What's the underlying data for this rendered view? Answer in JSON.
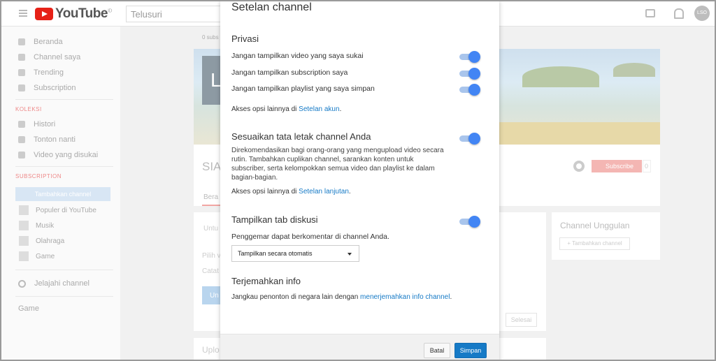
{
  "header": {
    "logo_text": "YouTube",
    "logo_sup": "ID",
    "search_placeholder": "Telusuri",
    "avatar_text": "LSO"
  },
  "sidebar": {
    "main_items": [
      {
        "label": "Beranda",
        "icon": "home-icon"
      },
      {
        "label": "Channel saya",
        "icon": "person-icon"
      },
      {
        "label": "Trending",
        "icon": "flame-icon"
      },
      {
        "label": "Subscription",
        "icon": "subscription-icon"
      }
    ],
    "collection_heading": "KOLEKSI",
    "collection_items": [
      {
        "label": "Histori",
        "icon": "hourglass-icon"
      },
      {
        "label": "Tonton nanti",
        "icon": "clock-icon"
      },
      {
        "label": "Video yang disukai",
        "icon": "thumb-up-icon"
      }
    ],
    "subscription_heading": "SUBSCRIPTION",
    "subscription_highlight": "Tambahkan channel",
    "subscriptions": [
      {
        "label": "Populer di YouTube"
      },
      {
        "label": "Musik"
      },
      {
        "label": "Olahraga"
      },
      {
        "label": "Game"
      }
    ],
    "explore_label": "Jelajahi channel",
    "game_label": "Game"
  },
  "background": {
    "subs_count": "0 subs",
    "banner_letter": "L",
    "channel_name": "SIA",
    "subscribe_label": "Subscribe",
    "subscribe_count": "0",
    "tab_home": "Bera",
    "content_tab": "Untu",
    "content_line1": "Pilih v",
    "content_line2": "Catat",
    "content_btn": "Un",
    "done_label": "Selesai",
    "featured_title": "Channel Unggulan",
    "featured_add": "+ Tambahkan channel",
    "uploads_label": "Uplo"
  },
  "modal": {
    "title": "Setelan channel",
    "privacy": {
      "heading": "Privasi",
      "options": [
        {
          "label": "Jangan tampilkan video yang saya sukai",
          "checked": true
        },
        {
          "label": "Jangan tampilkan subscription saya",
          "checked": true
        },
        {
          "label": "Jangan tampilkan playlist yang saya simpan",
          "checked": true
        }
      ],
      "more_prefix": "Akses opsi lainnya di ",
      "more_link": "Setelan akun",
      "more_suffix": "."
    },
    "layout": {
      "heading": "Sesuaikan tata letak channel Anda",
      "checked": true,
      "description": "Direkomendasikan bagi orang-orang yang mengupload video secara rutin. Tambahkan cuplikan channel, sarankan konten untuk subscriber, serta kelompokkan semua video dan playlist ke dalam bagian-bagian.",
      "more_prefix": "Akses opsi lainnya di ",
      "more_link": "Setelan lanjutan",
      "more_suffix": "."
    },
    "discussion": {
      "heading": "Tampilkan tab diskusi",
      "checked": true,
      "description": "Penggemar dapat berkomentar di channel Anda.",
      "select_value": "Tampilkan secara otomatis"
    },
    "translate": {
      "heading": "Terjemahkan info",
      "prefix": "Jangkau penonton di negara lain dengan ",
      "link": "menerjemahkan info channel",
      "suffix": "."
    },
    "footer": {
      "cancel": "Batal",
      "save": "Simpan"
    }
  },
  "colors": {
    "accent": "#167ac6",
    "toggle_on": "#4285f4",
    "youtube_red": "#e62117"
  }
}
